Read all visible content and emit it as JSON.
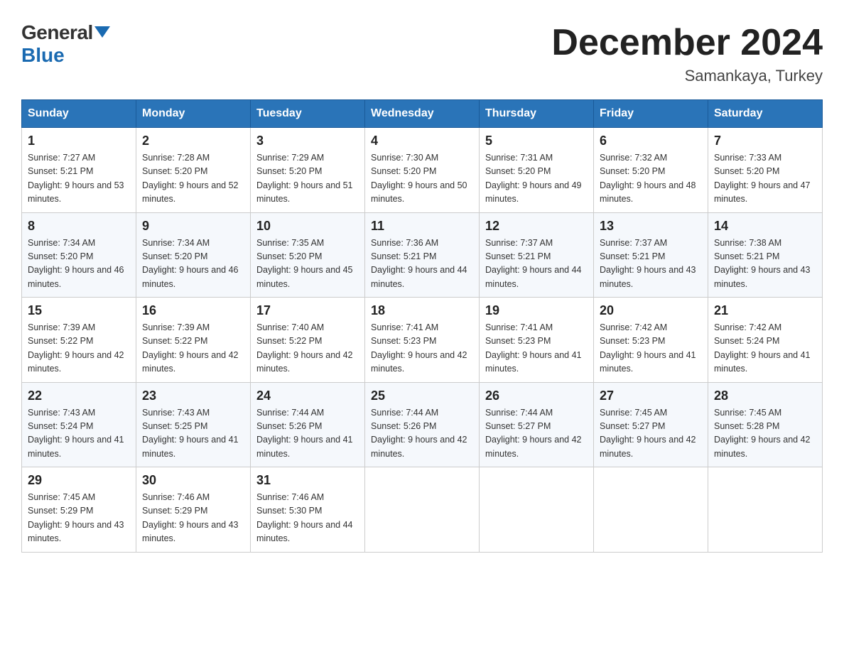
{
  "header": {
    "logo": {
      "general": "General",
      "blue": "Blue",
      "triangle": "▶"
    },
    "title": "December 2024",
    "location": "Samankaya, Turkey"
  },
  "columns": [
    "Sunday",
    "Monday",
    "Tuesday",
    "Wednesday",
    "Thursday",
    "Friday",
    "Saturday"
  ],
  "weeks": [
    [
      {
        "day": "1",
        "sunrise": "7:27 AM",
        "sunset": "5:21 PM",
        "daylight": "9 hours and 53 minutes."
      },
      {
        "day": "2",
        "sunrise": "7:28 AM",
        "sunset": "5:20 PM",
        "daylight": "9 hours and 52 minutes."
      },
      {
        "day": "3",
        "sunrise": "7:29 AM",
        "sunset": "5:20 PM",
        "daylight": "9 hours and 51 minutes."
      },
      {
        "day": "4",
        "sunrise": "7:30 AM",
        "sunset": "5:20 PM",
        "daylight": "9 hours and 50 minutes."
      },
      {
        "day": "5",
        "sunrise": "7:31 AM",
        "sunset": "5:20 PM",
        "daylight": "9 hours and 49 minutes."
      },
      {
        "day": "6",
        "sunrise": "7:32 AM",
        "sunset": "5:20 PM",
        "daylight": "9 hours and 48 minutes."
      },
      {
        "day": "7",
        "sunrise": "7:33 AM",
        "sunset": "5:20 PM",
        "daylight": "9 hours and 47 minutes."
      }
    ],
    [
      {
        "day": "8",
        "sunrise": "7:34 AM",
        "sunset": "5:20 PM",
        "daylight": "9 hours and 46 minutes."
      },
      {
        "day": "9",
        "sunrise": "7:34 AM",
        "sunset": "5:20 PM",
        "daylight": "9 hours and 46 minutes."
      },
      {
        "day": "10",
        "sunrise": "7:35 AM",
        "sunset": "5:20 PM",
        "daylight": "9 hours and 45 minutes."
      },
      {
        "day": "11",
        "sunrise": "7:36 AM",
        "sunset": "5:21 PM",
        "daylight": "9 hours and 44 minutes."
      },
      {
        "day": "12",
        "sunrise": "7:37 AM",
        "sunset": "5:21 PM",
        "daylight": "9 hours and 44 minutes."
      },
      {
        "day": "13",
        "sunrise": "7:37 AM",
        "sunset": "5:21 PM",
        "daylight": "9 hours and 43 minutes."
      },
      {
        "day": "14",
        "sunrise": "7:38 AM",
        "sunset": "5:21 PM",
        "daylight": "9 hours and 43 minutes."
      }
    ],
    [
      {
        "day": "15",
        "sunrise": "7:39 AM",
        "sunset": "5:22 PM",
        "daylight": "9 hours and 42 minutes."
      },
      {
        "day": "16",
        "sunrise": "7:39 AM",
        "sunset": "5:22 PM",
        "daylight": "9 hours and 42 minutes."
      },
      {
        "day": "17",
        "sunrise": "7:40 AM",
        "sunset": "5:22 PM",
        "daylight": "9 hours and 42 minutes."
      },
      {
        "day": "18",
        "sunrise": "7:41 AM",
        "sunset": "5:23 PM",
        "daylight": "9 hours and 42 minutes."
      },
      {
        "day": "19",
        "sunrise": "7:41 AM",
        "sunset": "5:23 PM",
        "daylight": "9 hours and 41 minutes."
      },
      {
        "day": "20",
        "sunrise": "7:42 AM",
        "sunset": "5:23 PM",
        "daylight": "9 hours and 41 minutes."
      },
      {
        "day": "21",
        "sunrise": "7:42 AM",
        "sunset": "5:24 PM",
        "daylight": "9 hours and 41 minutes."
      }
    ],
    [
      {
        "day": "22",
        "sunrise": "7:43 AM",
        "sunset": "5:24 PM",
        "daylight": "9 hours and 41 minutes."
      },
      {
        "day": "23",
        "sunrise": "7:43 AM",
        "sunset": "5:25 PM",
        "daylight": "9 hours and 41 minutes."
      },
      {
        "day": "24",
        "sunrise": "7:44 AM",
        "sunset": "5:26 PM",
        "daylight": "9 hours and 41 minutes."
      },
      {
        "day": "25",
        "sunrise": "7:44 AM",
        "sunset": "5:26 PM",
        "daylight": "9 hours and 42 minutes."
      },
      {
        "day": "26",
        "sunrise": "7:44 AM",
        "sunset": "5:27 PM",
        "daylight": "9 hours and 42 minutes."
      },
      {
        "day": "27",
        "sunrise": "7:45 AM",
        "sunset": "5:27 PM",
        "daylight": "9 hours and 42 minutes."
      },
      {
        "day": "28",
        "sunrise": "7:45 AM",
        "sunset": "5:28 PM",
        "daylight": "9 hours and 42 minutes."
      }
    ],
    [
      {
        "day": "29",
        "sunrise": "7:45 AM",
        "sunset": "5:29 PM",
        "daylight": "9 hours and 43 minutes."
      },
      {
        "day": "30",
        "sunrise": "7:46 AM",
        "sunset": "5:29 PM",
        "daylight": "9 hours and 43 minutes."
      },
      {
        "day": "31",
        "sunrise": "7:46 AM",
        "sunset": "5:30 PM",
        "daylight": "9 hours and 44 minutes."
      },
      null,
      null,
      null,
      null
    ]
  ]
}
